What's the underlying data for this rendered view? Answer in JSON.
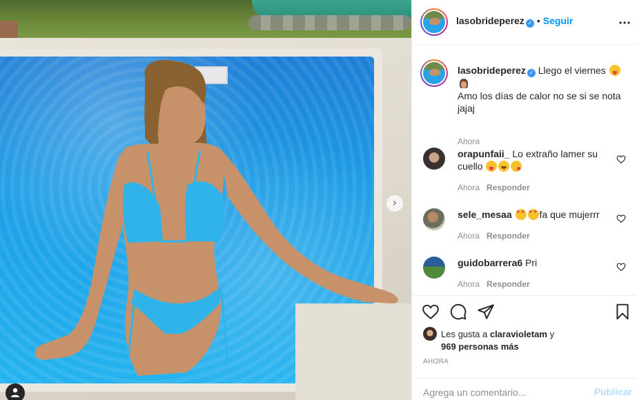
{
  "post": {
    "author": "lasobrideperez",
    "follow_label": "Seguir",
    "header_separator": "•",
    "caption_line1": "Llego el viernes",
    "caption_line2": "Amo los días de calor no se si se nota jajaj",
    "caption_time": "Ahora"
  },
  "comments": [
    {
      "user": "orapunfaii_",
      "text": "Lo extraño lamer su cuello",
      "time": "Ahora",
      "reply_label": "Responder"
    },
    {
      "user": "sele_mesaa",
      "text": "fa que mujerrr",
      "time": "Ahora",
      "reply_label": "Responder"
    },
    {
      "user": "guidobarrera6",
      "text": "Pri",
      "time": "Ahora",
      "reply_label": "Responder"
    }
  ],
  "likes": {
    "prefix": "Les gusta a",
    "user": "claravioletam",
    "conj": "y",
    "others": "969 personas más"
  },
  "post_time": "AHORA",
  "add_comment": {
    "placeholder": "Agrega un comentario...",
    "post_label": "Publicar"
  },
  "icons": {
    "verified": "verified-badge-icon",
    "more": "more-options-icon",
    "like": "heart-icon",
    "comment": "comment-bubble-icon",
    "share": "paper-plane-icon",
    "save": "bookmark-icon",
    "next": "chevron-right-icon",
    "tags": "user-tag-icon"
  },
  "colors": {
    "link_blue": "#0095f6",
    "verified_blue": "#3897f0",
    "muted_text": "#8e8e8e",
    "publish_disabled": "#b2dffc"
  }
}
